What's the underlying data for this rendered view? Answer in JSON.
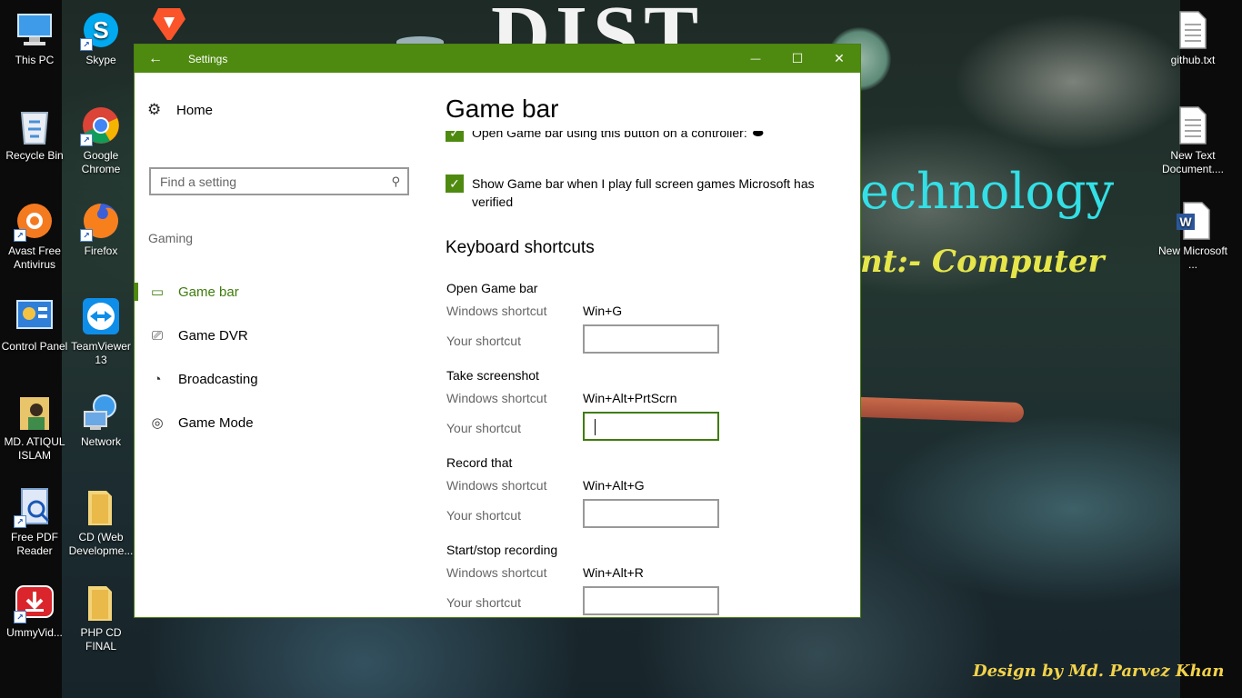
{
  "desktop": {
    "left_column_1": [
      {
        "label": "This PC",
        "icon": "computer-icon"
      },
      {
        "label": "Recycle Bin",
        "icon": "recycle-bin-icon"
      },
      {
        "label": "Avast Free Antivirus",
        "icon": "avast-icon"
      },
      {
        "label": "Control Panel",
        "icon": "control-panel-icon"
      },
      {
        "label": "MD. ATIQUL ISLAM",
        "icon": "user-folder-icon"
      },
      {
        "label": "Free PDF Reader",
        "icon": "pdf-reader-icon"
      },
      {
        "label": "UmmyVid...",
        "icon": "ummy-download-icon"
      }
    ],
    "left_column_2": [
      {
        "label": "Skype",
        "icon": "skype-icon"
      },
      {
        "label": "Google Chrome",
        "icon": "chrome-icon"
      },
      {
        "label": "Firefox",
        "icon": "firefox-icon"
      },
      {
        "label": "TeamViewer 13",
        "icon": "teamviewer-icon"
      },
      {
        "label": "Network",
        "icon": "network-icon"
      },
      {
        "label": "CD (Web Developme...",
        "icon": "folder-icon"
      },
      {
        "label": "PHP CD FINAL",
        "icon": "folder-icon"
      }
    ],
    "right_column": [
      {
        "label": "github.txt",
        "icon": "text-file-icon"
      },
      {
        "label": "New Text Document....",
        "icon": "text-file-icon"
      },
      {
        "label": "New Microsoft ...",
        "icon": "word-document-icon"
      }
    ],
    "wallpaper": {
      "banner_text": "DIST",
      "tech_text": "echnology",
      "dept_text": "nt:- Computer",
      "credit_text": "Design by Md. Parvez Khan"
    }
  },
  "window": {
    "title": "Settings",
    "back_glyph": "←",
    "minimize_glyph": "—",
    "maximize_glyph": "☐",
    "close_glyph": "✕",
    "accent_color": "#4f8a10"
  },
  "nav": {
    "home_label": "Home",
    "search_placeholder": "Find a setting",
    "group_label": "Gaming",
    "items": [
      {
        "label": "Game bar",
        "icon": "game-bar-icon",
        "active": true
      },
      {
        "label": "Game DVR",
        "icon": "game-dvr-icon",
        "active": false
      },
      {
        "label": "Broadcasting",
        "icon": "broadcasting-icon",
        "active": false
      },
      {
        "label": "Game Mode",
        "icon": "game-mode-icon",
        "active": false
      }
    ]
  },
  "content": {
    "page_title": "Game bar",
    "checkbox_1": {
      "label": "Open Game bar using this button on a controller:",
      "checked": true
    },
    "checkbox_2": {
      "label": "Show Game bar when I play full screen games Microsoft has verified",
      "checked": true
    },
    "section_title": "Keyboard shortcuts",
    "windows_shortcut_label": "Windows shortcut",
    "your_shortcut_label": "Your shortcut",
    "shortcuts": [
      {
        "title": "Open Game bar",
        "windows_shortcut": "Win+G",
        "your_shortcut": ""
      },
      {
        "title": "Take screenshot",
        "windows_shortcut": "Win+Alt+PrtScrn",
        "your_shortcut": "",
        "focused": true
      },
      {
        "title": "Record that",
        "windows_shortcut": "Win+Alt+G",
        "your_shortcut": ""
      },
      {
        "title": "Start/stop recording",
        "windows_shortcut": "Win+Alt+R",
        "your_shortcut": ""
      }
    ]
  }
}
